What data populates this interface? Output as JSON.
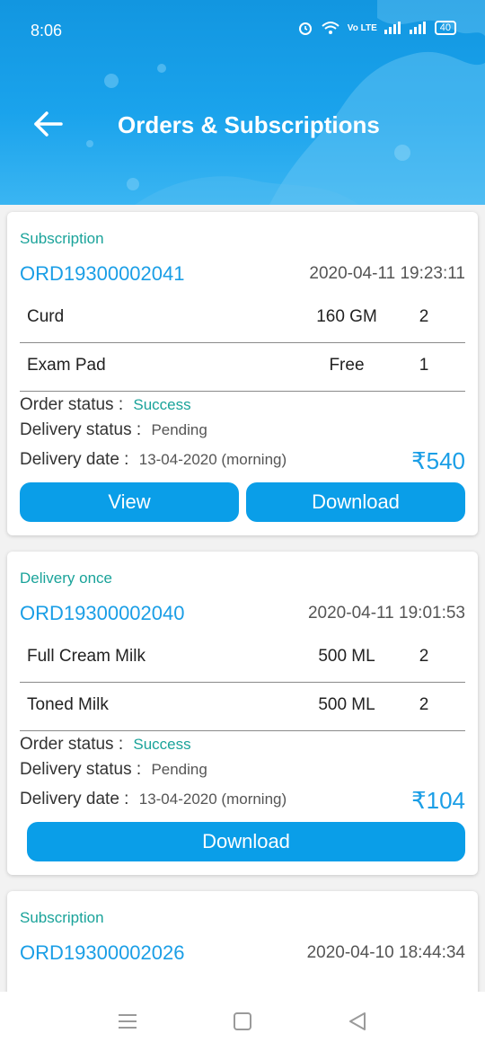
{
  "status_bar": {
    "time": "8:06",
    "network_label": "Vo LTE",
    "battery": "40"
  },
  "header": {
    "title": "Orders & Subscriptions",
    "back_icon": "arrow-left-icon",
    "accent_color": "#1a9ee6"
  },
  "labels": {
    "order_status": "Order status :",
    "delivery_status": "Delivery status :",
    "delivery_date": "Delivery date :"
  },
  "orders": [
    {
      "type": "Subscription",
      "id": "ORD19300002041",
      "datetime": "2020-04-11 19:23:11",
      "items": [
        {
          "name": "Curd",
          "qty": "160 GM",
          "count": "2"
        },
        {
          "name": "Exam Pad",
          "qty": "Free",
          "count": "1"
        }
      ],
      "order_status": "Success",
      "delivery_status": "Pending",
      "delivery_date": "13-04-2020 (morning)",
      "price": "₹540",
      "buttons": {
        "view": "View",
        "download": "Download"
      }
    },
    {
      "type": "Delivery once",
      "id": "ORD19300002040",
      "datetime": "2020-04-11 19:01:53",
      "items": [
        {
          "name": "Full Cream Milk",
          "qty": "500 ML",
          "count": "2"
        },
        {
          "name": "Toned Milk",
          "qty": "500 ML",
          "count": "2"
        }
      ],
      "order_status": "Success",
      "delivery_status": "Pending",
      "delivery_date": "13-04-2020 (morning)",
      "price": "₹104",
      "buttons": {
        "download": "Download"
      }
    },
    {
      "type": "Subscription",
      "id": "ORD19300002026",
      "datetime": "2020-04-10 18:44:34"
    }
  ],
  "nav_bar": {
    "icons": [
      "menu-icon",
      "home-square-icon",
      "back-triangle-icon"
    ]
  }
}
